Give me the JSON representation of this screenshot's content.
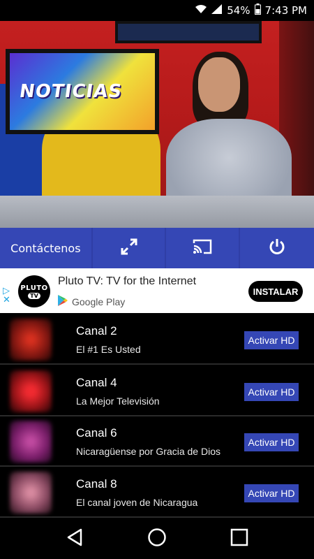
{
  "status_bar": {
    "battery": "54%",
    "time": "7:43 PM",
    "icons": [
      "wifi-icon",
      "signal-icon",
      "battery-icon"
    ]
  },
  "toolbar": {
    "contact_label": "Contáctenos",
    "icons": [
      "fullscreen-icon",
      "cast-icon",
      "power-icon"
    ]
  },
  "ad": {
    "logo_line1": "PLUTO",
    "logo_line2": "TV",
    "title": "Pluto TV: TV for the Internet",
    "store": "Google Play",
    "install_label": "INSTALAR"
  },
  "channels": [
    {
      "name": "Canal 2",
      "description": "El #1 Es Usted",
      "action": "Activar HD",
      "thumb_color": "#c8281e"
    },
    {
      "name": "Canal 4",
      "description": "La Mejor Televisión",
      "action": "Activar HD",
      "thumb_color": "#d31e28"
    },
    {
      "name": "Canal 6",
      "description": "Nicaragüense por Gracia de Dios",
      "action": "Activar HD",
      "thumb_color": "#a0287a"
    },
    {
      "name": "Canal 8",
      "description": "El canal joven de Nicaragua",
      "action": "Activar HD",
      "thumb_color": "#b5607a"
    }
  ],
  "video": {
    "banner_text": "NOTICIAS"
  },
  "colors": {
    "accent": "#3547b5",
    "toolbar_bg": "#2f3ea6"
  }
}
